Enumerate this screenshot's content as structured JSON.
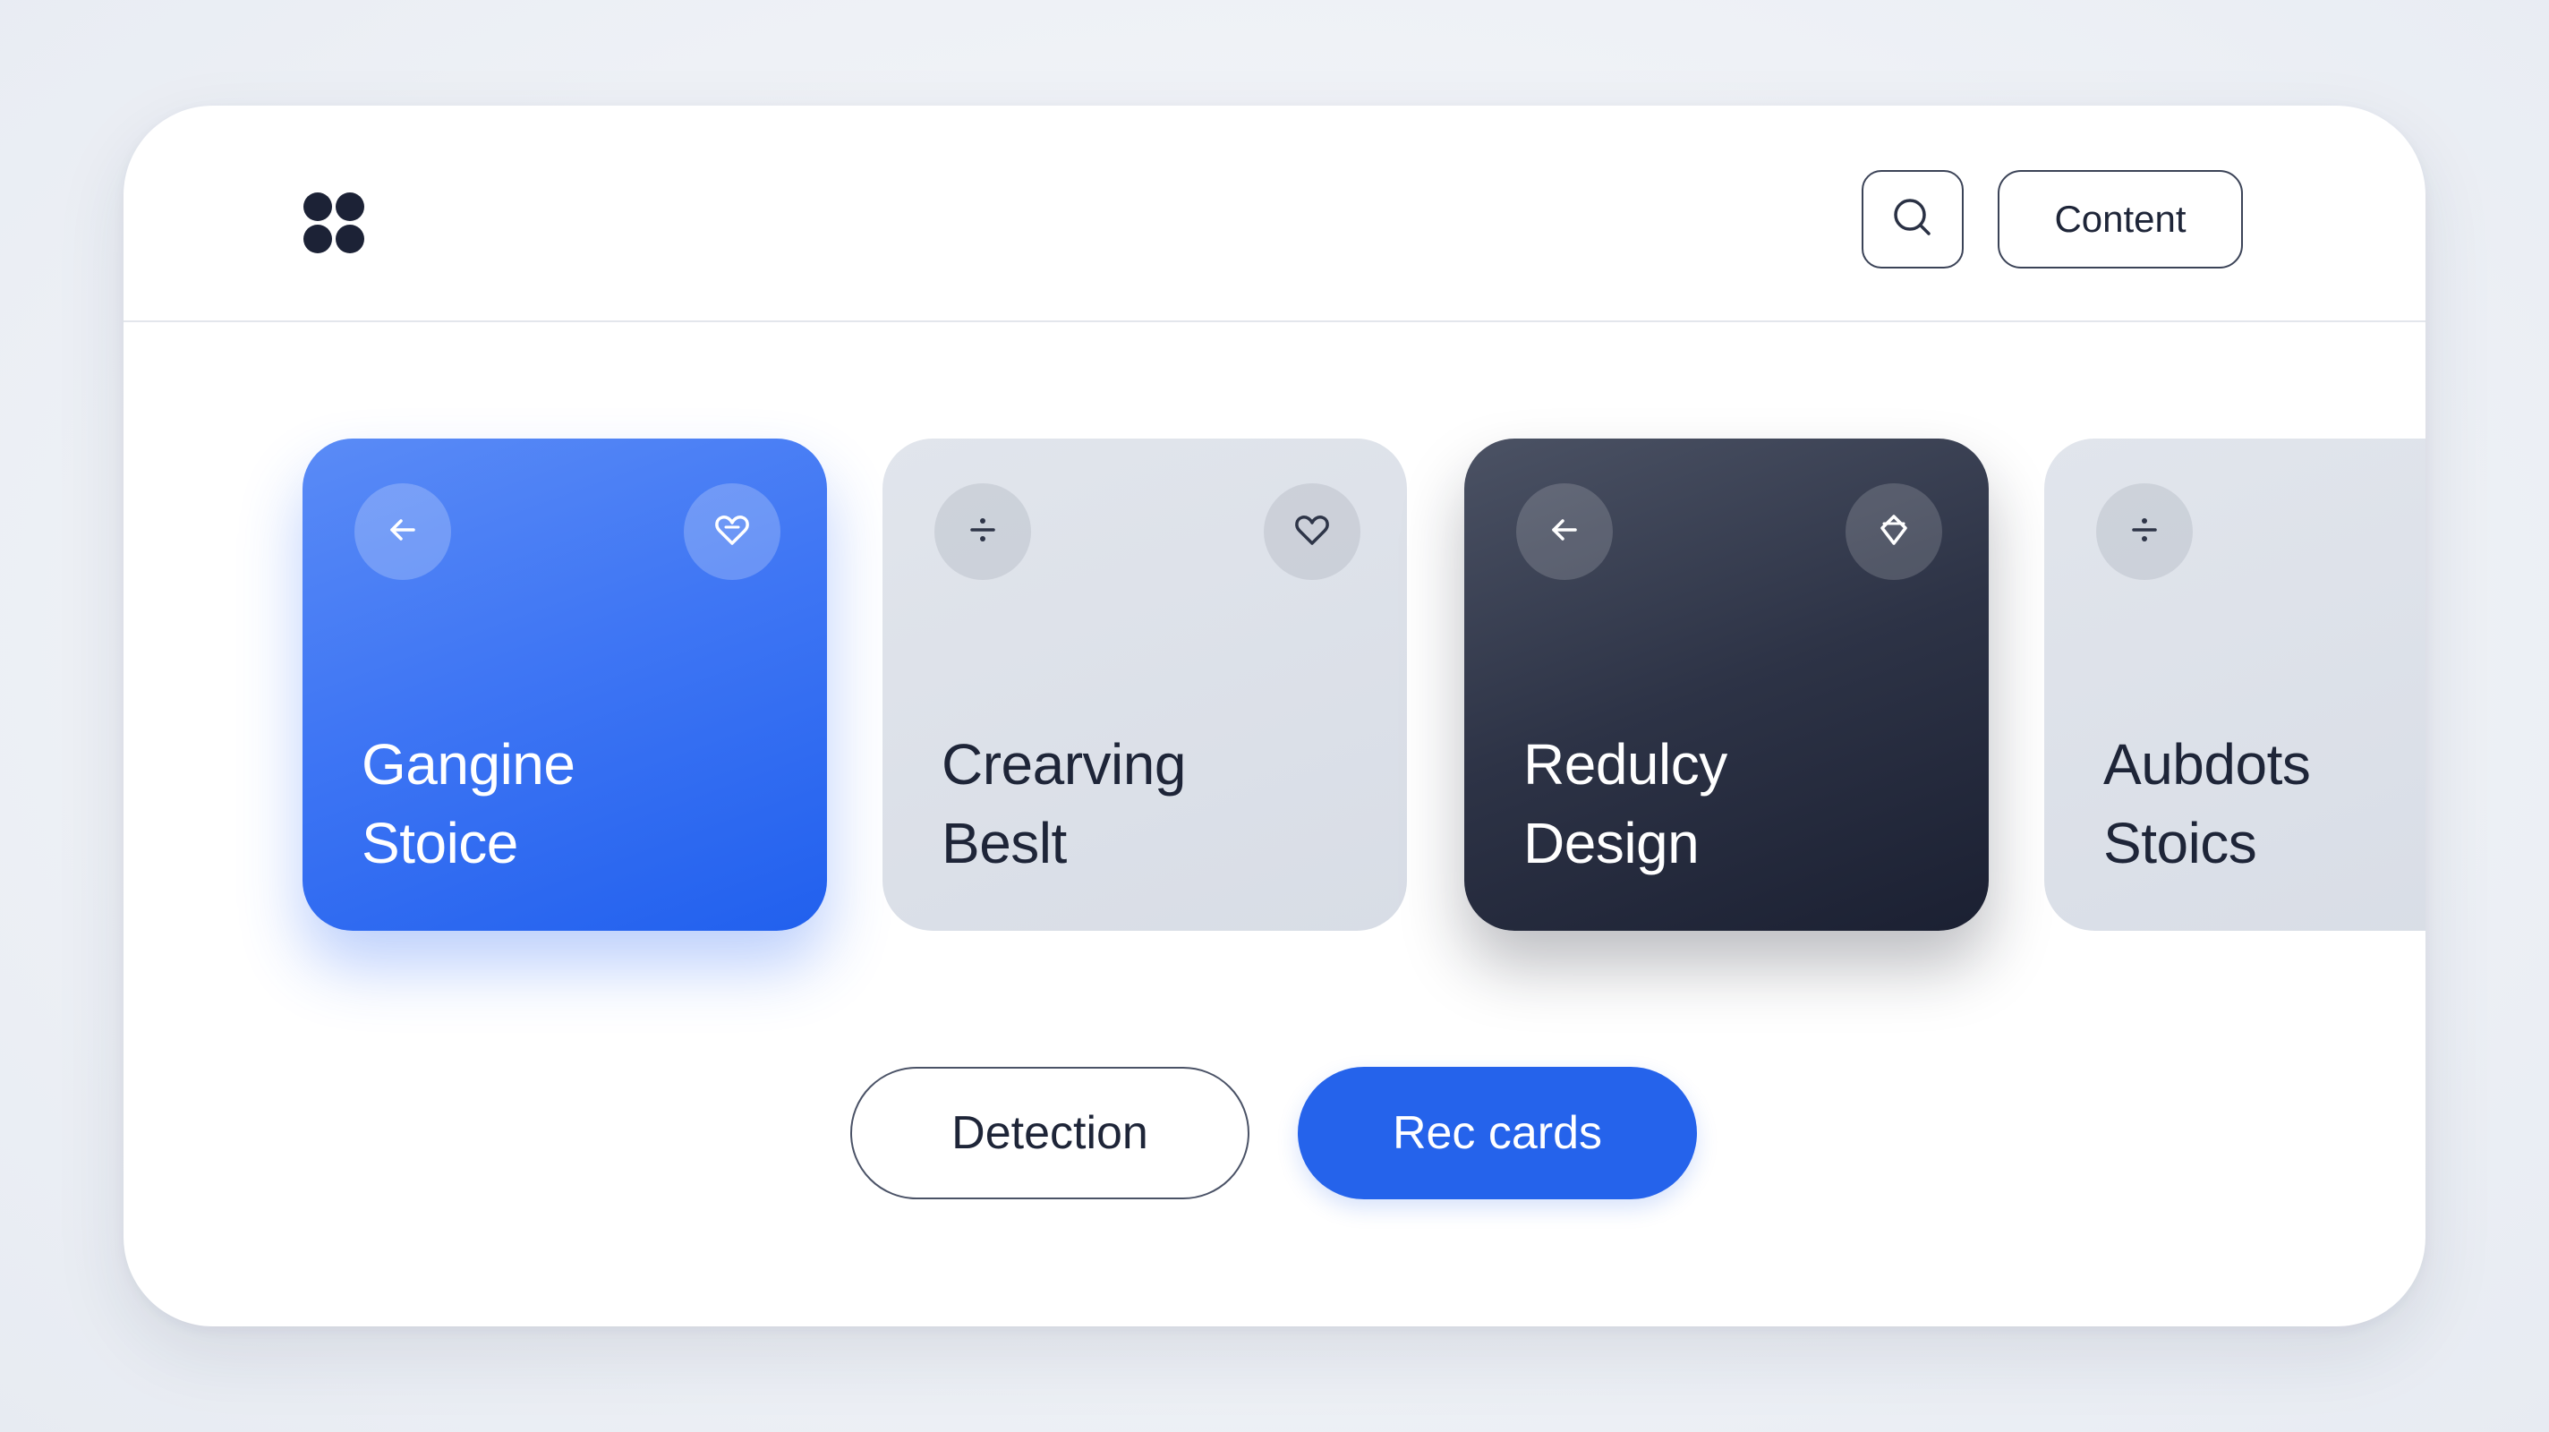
{
  "header": {
    "logo_icon": "four-petal-logo-icon",
    "search_icon": "search-icon",
    "content_button_label": "Content"
  },
  "cards": [
    {
      "title_line1": "Gangine",
      "title_line2": "Stoice",
      "theme": "blue",
      "left_icon": "arrow-left-icon",
      "right_icon": "heart-icon"
    },
    {
      "title_line1": "Crearving",
      "title_line2": "Beslt",
      "theme": "gray",
      "left_icon": "divide-icon",
      "right_icon": "heart-icon"
    },
    {
      "title_line1": "Redulcy",
      "title_line2": "Design",
      "theme": "dark",
      "left_icon": "arrow-left-icon",
      "right_icon": "diamond-icon"
    },
    {
      "title_line1": "Aubdots",
      "title_line2": "Stoics",
      "theme": "gray",
      "left_icon": "divide-icon"
    }
  ],
  "actions": {
    "detection_label": "Detection",
    "rec_cards_label": "Rec cards"
  },
  "colors": {
    "accent": "#2563eb",
    "dark_card": "#2d3346",
    "gray_card": "#dde1e8",
    "text_dark": "#1e2538"
  }
}
